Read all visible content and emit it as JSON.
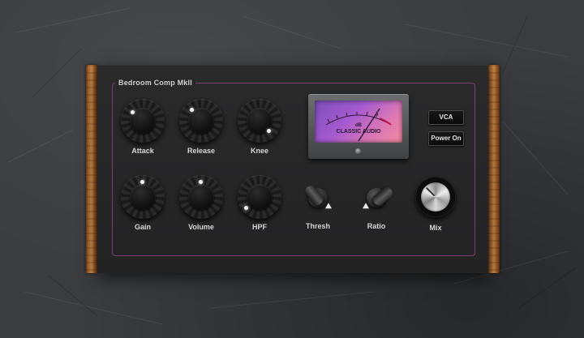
{
  "plugin": {
    "title": "Bedroom Comp MkII",
    "frame_color": "#7a3f74"
  },
  "knobs": [
    {
      "id": "attack",
      "label": "Attack"
    },
    {
      "id": "release",
      "label": "Release"
    },
    {
      "id": "knee",
      "label": "Knee"
    },
    {
      "id": "gain",
      "label": "Gain"
    },
    {
      "id": "volume",
      "label": "Volume"
    },
    {
      "id": "hpf",
      "label": "HPF"
    }
  ],
  "toggles": [
    {
      "id": "thresh",
      "label": "Thresh"
    },
    {
      "id": "ratio",
      "label": "Ratio"
    }
  ],
  "mix": {
    "label": "Mix"
  },
  "meter": {
    "unit": "dB",
    "brand": "CLASSIC AUDIO",
    "face_colors": [
      "#7d4fb7",
      "#f08aa0"
    ]
  },
  "buttons": {
    "vca": "VCA",
    "power": "Power On"
  }
}
